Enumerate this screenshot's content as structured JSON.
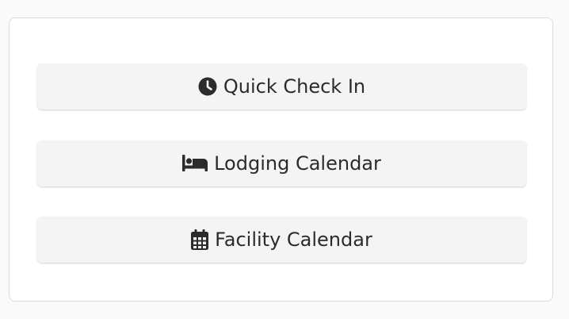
{
  "buttons": [
    {
      "label": "Quick Check In",
      "icon": "clock-icon"
    },
    {
      "label": "Lodging Calendar",
      "icon": "bed-icon"
    },
    {
      "label": "Facility Calendar",
      "icon": "calendar-icon"
    }
  ],
  "colors": {
    "button_bg": "#f4f4f4",
    "text": "#2b2b2b",
    "panel_border": "#dcdcdc"
  }
}
